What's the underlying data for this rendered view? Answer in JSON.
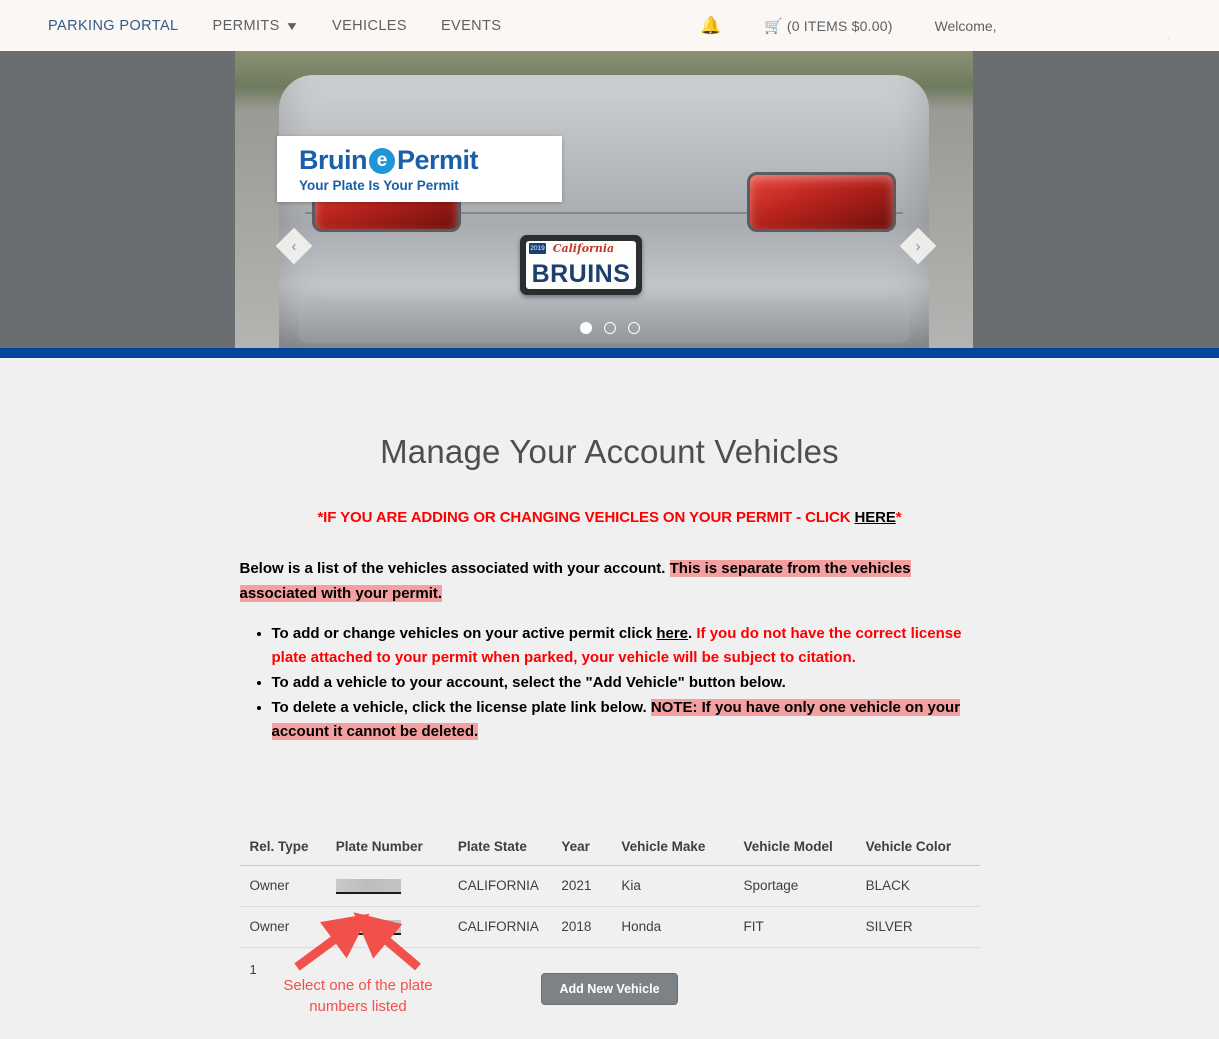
{
  "header": {
    "nav": [
      {
        "label": "PARKING PORTAL",
        "brand": true,
        "caret": false
      },
      {
        "label": "PERMITS",
        "brand": false,
        "caret": true
      },
      {
        "label": "VEHICLES",
        "brand": false,
        "caret": false
      },
      {
        "label": "EVENTS",
        "brand": false,
        "caret": false
      }
    ],
    "bell_icon": "bell-icon",
    "cart_icon": "cart-icon",
    "cart_text": "(0 ITEMS $0.00)",
    "welcome": "Welcome,",
    "background": "#fbf7f4"
  },
  "hero": {
    "logo": {
      "word_first": "Bruin",
      "badge": "e",
      "word_second": "Permit",
      "tagline": "Your Plate Is Your Permit"
    },
    "plate": {
      "state": "California",
      "tag_year": "2019",
      "number": "BRUINS"
    },
    "prev_arrow": "‹",
    "next_arrow": "›",
    "dots": 3,
    "active_dot": 0,
    "divider_color": "#00459b"
  },
  "main": {
    "title": "Manage Your Account Vehicles",
    "alert": {
      "before": "*IF YOU ARE ADDING OR CHANGING VEHICLES ON YOUR PERMIT - CLICK ",
      "link": "HERE",
      "after": "*",
      "color": "#ff0000"
    },
    "intro": {
      "plain": "Below is a list of the vehicles associated with your account. ",
      "highlighted": "This is separate from the vehicles associated with your permit."
    },
    "bullets": [
      {
        "plain_before": "To add or change vehicles on your active permit click ",
        "link": "here",
        "plain_after": ". ",
        "red": "If you do not have the correct license plate attached to your permit when parked, your vehicle will be subject to citation."
      },
      {
        "plain_before": "To add a vehicle to your account, select the \"Add Vehicle\" button below.",
        "link": "",
        "plain_after": "",
        "red": ""
      },
      {
        "plain_before": "To delete a vehicle, click the license plate link below. ",
        "link": "",
        "plain_after": "",
        "highlighted": "NOTE: If you have only one vehicle on your account it cannot be deleted."
      }
    ],
    "highlight_color": "#f4a0a0"
  },
  "table": {
    "columns": [
      "Rel. Type",
      "Plate Number",
      "Plate State",
      "Year",
      "Vehicle Make",
      "Vehicle Model",
      "Vehicle Color"
    ],
    "rows": [
      {
        "rel_type": "Owner",
        "plate_number": "",
        "plate_state": "CALIFORNIA",
        "year": "2021",
        "make": "Kia",
        "model": "Sportage",
        "color": "BLACK"
      },
      {
        "rel_type": "Owner",
        "plate_number": "",
        "plate_state": "CALIFORNIA",
        "year": "2018",
        "make": "Honda",
        "model": "FIT",
        "color": "SILVER"
      }
    ],
    "page_number": "1"
  },
  "actions": {
    "add_vehicle_label": "Add New Vehicle",
    "button_color": "#7d8287"
  },
  "annotation": {
    "text": "Select one of the plate numbers listed",
    "color": "#f2504b",
    "arrow_count": 2
  }
}
